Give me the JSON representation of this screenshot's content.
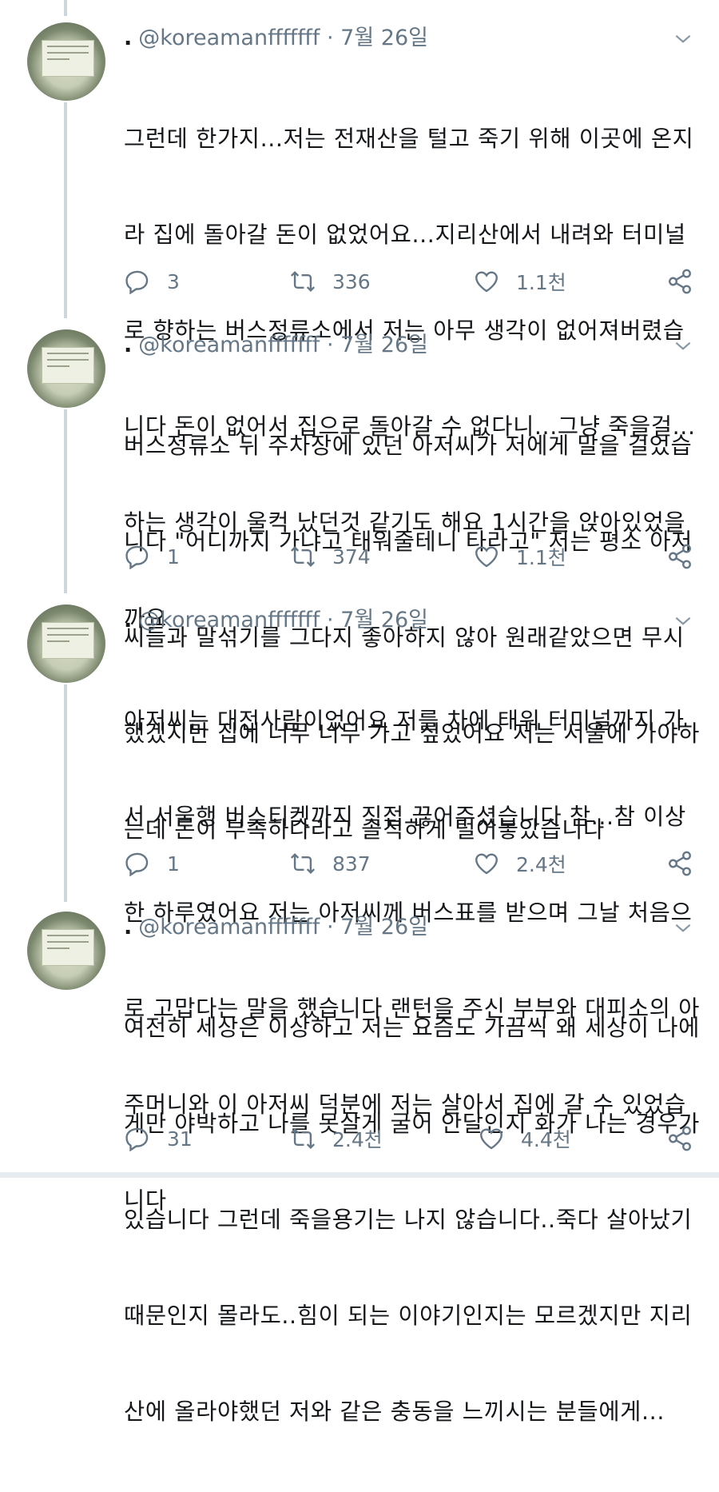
{
  "tweets": [
    {
      "dot": ".",
      "handle": "@koreamanfffffff",
      "date": "· 7월 26일",
      "lines": [
        "그런데 한가지...저는 전재산을 털고 죽기 위해 이곳에 온지",
        "라 집에 돌아갈 돈이 없었어요...지리산에서 내려와 터미널",
        "로 향하는 버스정류소에서 저는 아무 생각이 없어져버렸습",
        "니다 돈이 없어서 집으로 돌아갈 수 없다니...그냥 죽을걸...",
        "하는 생각이 울컥 났던것 같기도 해요 1시간을 앉아있었을",
        "까요"
      ],
      "replies": "3",
      "retweets": "336",
      "likes": "1.1천"
    },
    {
      "dot": ".",
      "handle": "@koreamanfffffff",
      "date": "· 7월 26일",
      "lines": [
        "버스정류소 뒤 주차장에 있던 아저씨가 저에게 말을 걸었습",
        "니다 \"어디까지 가냐고 태워줄테니 타라고\" 저는 평소 아저",
        "씨들과 말섞기를 그다지 좋아하지 않아 원래같았으면 무시",
        "했겠지만 집에 너무 너무 가고 싶었어요 저는 서울에 가야하",
        "는데 돈이 부족하다라고 솔직하게 털어놓았습니다"
      ],
      "replies": "1",
      "retweets": "374",
      "likes": "1.1천"
    },
    {
      "dot": ".",
      "handle": "@koreamanfffffff",
      "date": "· 7월 26일",
      "lines": [
        "아저씨는 대전사람이었어요 저를 차에 태워 터미널까지 가",
        "서 서울행 버스티켓까지 직접 끊어주셨습니다 참...참 이상",
        "한 하루였어요 저는 아저씨께 버스표를 받으며 그날 처음으",
        "로 고맙다는 말을 했습니다 랜턴을 주신 부부와 대피소의 아",
        "주머니와 이 아저씨 덕분에 저는 살아서 집에 갈 수 있었습",
        "니다"
      ],
      "replies": "1",
      "retweets": "837",
      "likes": "2.4천"
    },
    {
      "dot": ".",
      "handle": "@koreamanfffffff",
      "date": "· 7월 26일",
      "lines": [
        "여전히 세상은 이상하고 저는 요즘도 가끔씩 왜 세상이 나에",
        "게만 야박하고 나를 못살게 굴어 안달인지 화가 나는 경우가",
        "있습니다 그런데 죽을용기는 나지 않습니다..죽다 살아났기",
        "때문인지 몰라도..힘이 되는 이야기인지는 모르겠지만 지리",
        "산에 올라야했던 저와 같은 충동을 느끼시는 분들에게..."
      ],
      "replies": "31",
      "retweets": "2.4천",
      "likes": "4.4천"
    }
  ],
  "icons": {
    "reply": "reply-icon",
    "retweet": "retweet-icon",
    "like": "heart-icon",
    "share": "share-icon",
    "menu": "chevron-down-icon"
  },
  "colors": {
    "muted": "#657786",
    "text": "#14171a",
    "thread": "#ccd6dd"
  }
}
